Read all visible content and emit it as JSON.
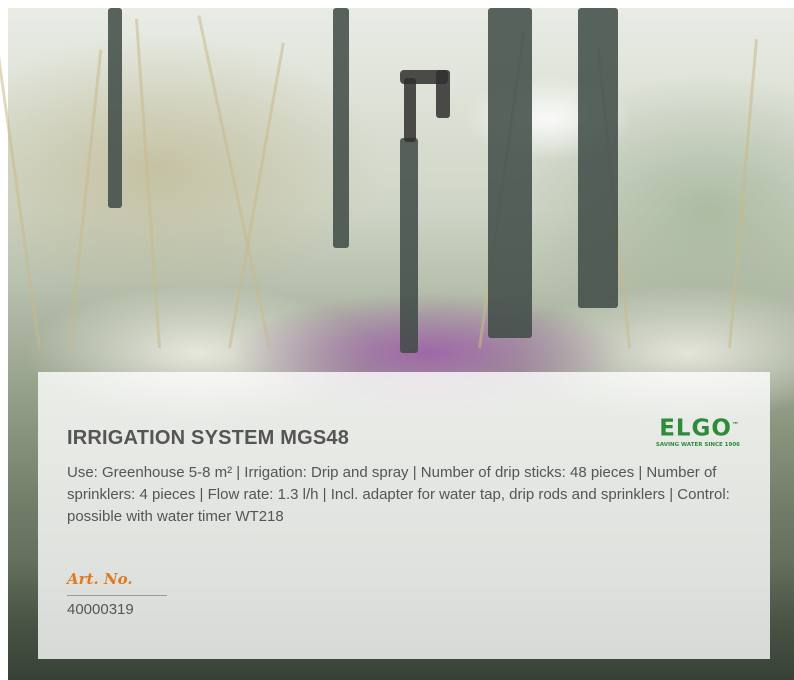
{
  "logo": {
    "word": "ELGO",
    "trademark": "™",
    "tagline": "SAVING WATER SINCE 1906",
    "color": "#2e8b3a"
  },
  "product": {
    "title": "IRRIGATION SYSTEM MGS48",
    "description": "Use: Greenhouse 5-8 m² | Irrigation: Drip and spray | Number of drip sticks: 48 pieces | Number of sprinklers: 4 pieces | Flow rate: 1.3 l/h | Incl. adapter for water tap, drip rods and sprinklers | Control: possible with water timer WT218",
    "art_label": "Art. No.",
    "art_number": "40000319",
    "accent_color": "#e07a1f"
  }
}
